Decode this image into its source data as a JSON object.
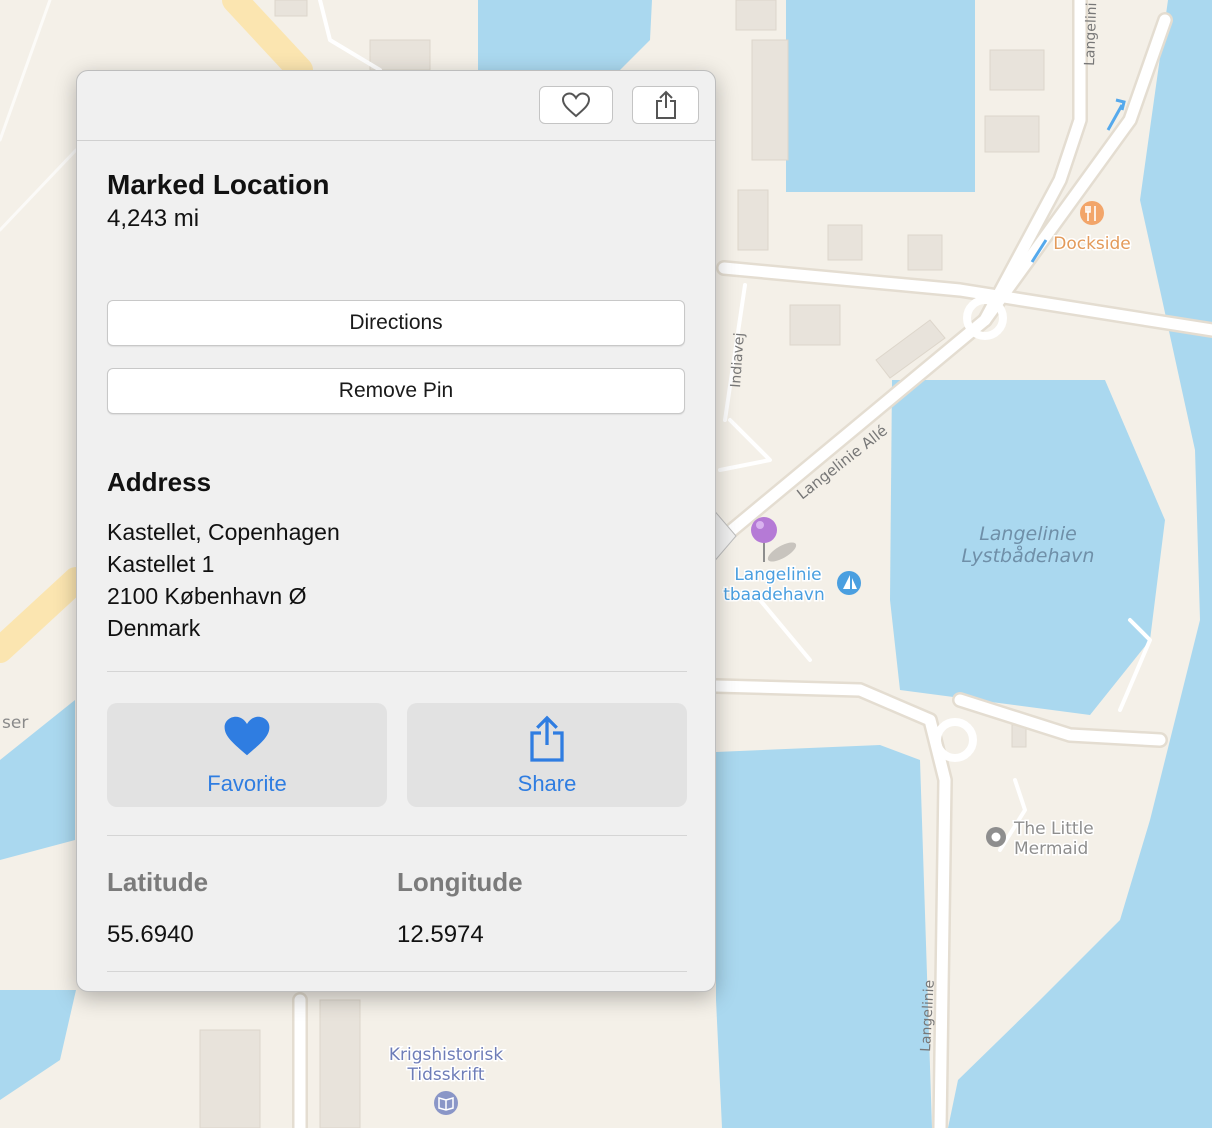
{
  "map": {
    "labels": {
      "dockside": "Dockside",
      "harbor_line1": "Langelinie",
      "harbor_line2": "Lystbådehavn",
      "marina_line1": "Langelinie",
      "marina_line2": "tbaadehavn",
      "mermaid_line1": "The Little",
      "mermaid_line2": "Mermaid",
      "krig_line1": "Krigshistorisk",
      "krig_line2": "Tidsskrift",
      "street_langelinie_alle": "Langelinie Allé",
      "street_indiavej": "Indiavej",
      "street_langelinie_bottom": "Langelinie",
      "street_langelinie_top": "Langelini",
      "fragment_left": "ser"
    },
    "colors": {
      "water": "#aad8ef",
      "land": "#f4f0e8",
      "road": "#ffffff",
      "road_casing": "#e4ddd1",
      "building": "#e8e3db",
      "pin": "#b57ad6",
      "poi_blue": "#4a9fe0",
      "poi_orange": "#e39a5a",
      "poi_gray": "#8e8e8e",
      "water_text": "#6f8fa8",
      "highway": "#fbe5b0"
    },
    "icons": [
      "fork-knife-icon",
      "sailboat-icon",
      "landmark-icon",
      "book-icon",
      "map-pin-icon"
    ]
  },
  "popover": {
    "toolbar": {
      "favorite_icon": "heart-outline-icon",
      "share_icon": "share-icon"
    },
    "title": "Marked Location",
    "distance": "4,243 mi",
    "directions_label": "Directions",
    "remove_pin_label": "Remove Pin",
    "address_heading": "Address",
    "address_lines": [
      "Kastellet, Copenhagen",
      "Kastellet 1",
      "2100 København Ø",
      "Denmark"
    ],
    "actions": {
      "favorite_label": "Favorite",
      "share_label": "Share",
      "accent_color": "#2f7de1"
    },
    "latitude_label": "Latitude",
    "latitude_value": "55.6940",
    "longitude_label": "Longitude",
    "longitude_value": "12.5974"
  }
}
